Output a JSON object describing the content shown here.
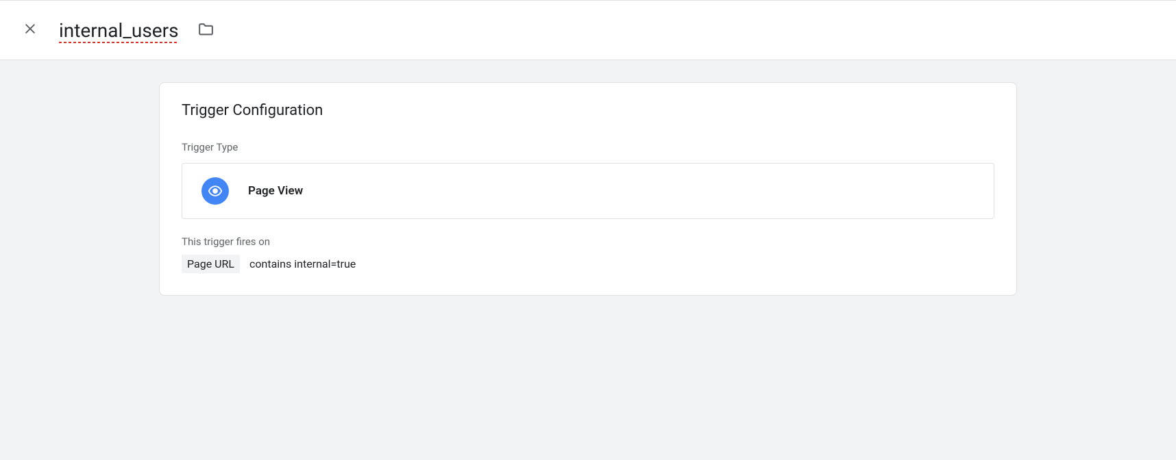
{
  "header": {
    "title": "internal_users"
  },
  "card": {
    "section_title": "Trigger Configuration",
    "type_label": "Trigger Type",
    "trigger_name": "Page View",
    "fires_on_label": "This trigger fires on",
    "condition_var": "Page URL",
    "condition_rest": "contains internal=true"
  }
}
